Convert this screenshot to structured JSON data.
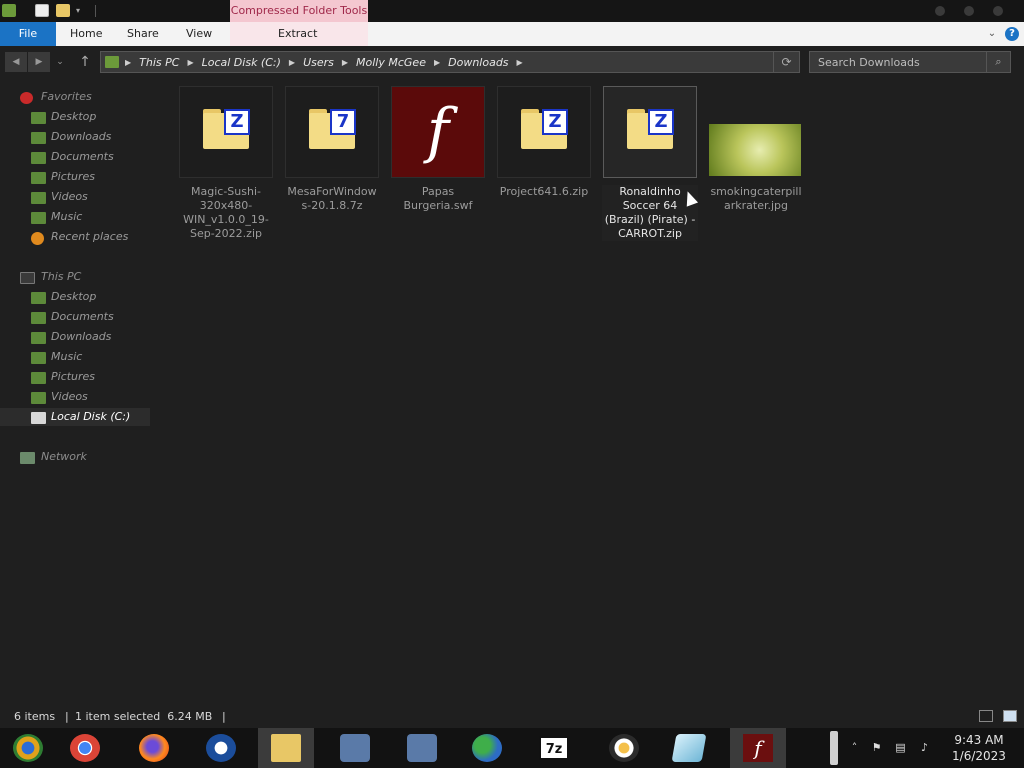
{
  "title_bar": {
    "contextual_tab": "Compressed Folder Tools"
  },
  "ribbon": {
    "tabs": [
      "File",
      "Home",
      "Share",
      "View",
      "Extract"
    ]
  },
  "address": {
    "crumbs": [
      "This PC",
      "Local Disk (C:)",
      "Users",
      "Molly McGee",
      "Downloads"
    ]
  },
  "search": {
    "placeholder": "Search Downloads"
  },
  "nav": {
    "favorites_label": "Favorites",
    "favorites": [
      "Desktop",
      "Downloads",
      "Documents",
      "Pictures",
      "Videos",
      "Music",
      "Recent places"
    ],
    "thispc_label": "This PC",
    "thispc": [
      "Desktop",
      "Documents",
      "Downloads",
      "Music",
      "Pictures",
      "Videos",
      "Local Disk (C:)"
    ],
    "network_label": "Network"
  },
  "files": [
    {
      "name": "Magic-Sushi-320x480-WIN_v1.0.0_19-Sep-2022.zip",
      "icon": "zip-folder-icon"
    },
    {
      "name": "MesaForWindows-20.1.8.7z",
      "icon": "7z-folder-icon"
    },
    {
      "name": "Papas Burgeria.swf",
      "icon": "flash-icon"
    },
    {
      "name": "Project641.6.zip",
      "icon": "zip-folder-icon"
    },
    {
      "name": "Ronaldinho Soccer 64 (Brazil) (Pirate) - CARROT.zip",
      "icon": "zip-folder-icon",
      "selected": true
    },
    {
      "name": "smokingcaterpillarkrater.jpg",
      "icon": "photo-thumbnail"
    }
  ],
  "status": {
    "count": "6 items",
    "selection": "1 item selected  6.24 MB"
  },
  "taskbar": {
    "apps": [
      "chrome-canary",
      "chrome",
      "firefox",
      "obama-logo",
      "file-explorer",
      "network-installer",
      "network-installer-2",
      "msn-messenger",
      "7-zip",
      "sushi-app",
      "notepad-glass",
      "flash-player"
    ],
    "time": "9:43 AM",
    "date": "1/6/2023"
  },
  "colors": {
    "accent": "#1b73c5",
    "contextual_tab_bg": "#f4c7d0",
    "background": "#1f1f1f",
    "taskbar": "#121212"
  }
}
